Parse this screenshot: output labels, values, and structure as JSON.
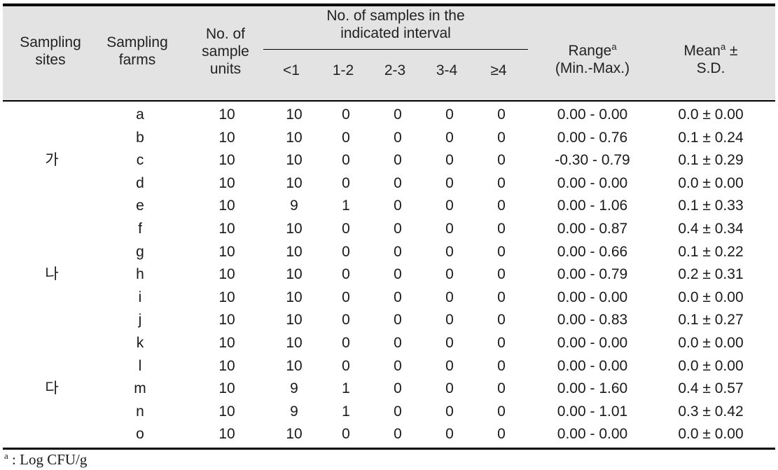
{
  "table": {
    "header": {
      "sites": "Sampling\nsites",
      "farms": "Sampling\nfarms",
      "units": "No. of\nsample\nunits",
      "interval_group": "No. of samples in the\nindicated interval",
      "intervals": [
        "<1",
        "1-2",
        "2-3",
        "3-4",
        "≥4"
      ],
      "range_label": "Range",
      "range_sup": "a",
      "range_sub": "(Min.-Max.)",
      "mean_label": "Mean",
      "mean_sup": "a",
      "mean_pm": " ±",
      "mean_sub": "S.D."
    },
    "rows": [
      {
        "site": "",
        "farm": "a",
        "units": "10",
        "i1": "10",
        "i2": "0",
        "i3": "0",
        "i4": "0",
        "i5": "0",
        "range": "0.00  -  0.00",
        "mean": "0.0  ±  0.00"
      },
      {
        "site": "",
        "farm": "b",
        "units": "10",
        "i1": "10",
        "i2": "0",
        "i3": "0",
        "i4": "0",
        "i5": "0",
        "range": "0.00  -  0.76",
        "mean": "0.1  ±  0.24"
      },
      {
        "site": "가",
        "farm": "c",
        "units": "10",
        "i1": "10",
        "i2": "0",
        "i3": "0",
        "i4": "0",
        "i5": "0",
        "range": "-0.30  -  0.79",
        "mean": "0.1  ±  0.29"
      },
      {
        "site": "",
        "farm": "d",
        "units": "10",
        "i1": "10",
        "i2": "0",
        "i3": "0",
        "i4": "0",
        "i5": "0",
        "range": "0.00  -  0.00",
        "mean": "0.0  ±  0.00"
      },
      {
        "site": "",
        "farm": "e",
        "units": "10",
        "i1": "9",
        "i2": "1",
        "i3": "0",
        "i4": "0",
        "i5": "0",
        "range": "0.00  -  1.06",
        "mean": "0.1  ±  0.33"
      },
      {
        "site": "",
        "farm": "f",
        "units": "10",
        "i1": "10",
        "i2": "0",
        "i3": "0",
        "i4": "0",
        "i5": "0",
        "range": "0.00  -  0.87",
        "mean": "0.4  ±  0.34"
      },
      {
        "site": "",
        "farm": "g",
        "units": "10",
        "i1": "10",
        "i2": "0",
        "i3": "0",
        "i4": "0",
        "i5": "0",
        "range": "0.00  -  0.66",
        "mean": "0.1  ±  0.22"
      },
      {
        "site": "나",
        "farm": "h",
        "units": "10",
        "i1": "10",
        "i2": "0",
        "i3": "0",
        "i4": "0",
        "i5": "0",
        "range": "0.00  -  0.79",
        "mean": "0.2  ±  0.31"
      },
      {
        "site": "",
        "farm": "i",
        "units": "10",
        "i1": "10",
        "i2": "0",
        "i3": "0",
        "i4": "0",
        "i5": "0",
        "range": "0.00  -  0.00",
        "mean": "0.0  ±  0.00"
      },
      {
        "site": "",
        "farm": "j",
        "units": "10",
        "i1": "10",
        "i2": "0",
        "i3": "0",
        "i4": "0",
        "i5": "0",
        "range": "0.00  -  0.83",
        "mean": "0.1  ±  0.27"
      },
      {
        "site": "",
        "farm": "k",
        "units": "10",
        "i1": "10",
        "i2": "0",
        "i3": "0",
        "i4": "0",
        "i5": "0",
        "range": "0.00  -  0.00",
        "mean": "0.0  ±  0.00"
      },
      {
        "site": "",
        "farm": "l",
        "units": "10",
        "i1": "10",
        "i2": "0",
        "i3": "0",
        "i4": "0",
        "i5": "0",
        "range": "0.00  -  0.00",
        "mean": "0.0  ±  0.00"
      },
      {
        "site": "다",
        "farm": "m",
        "units": "10",
        "i1": "9",
        "i2": "1",
        "i3": "0",
        "i4": "0",
        "i5": "0",
        "range": "0.00  -  1.60",
        "mean": "0.4  ±  0.57"
      },
      {
        "site": "",
        "farm": "n",
        "units": "10",
        "i1": "9",
        "i2": "1",
        "i3": "0",
        "i4": "0",
        "i5": "0",
        "range": "0.00  -  1.01",
        "mean": "0.3  ±  0.42"
      },
      {
        "site": "",
        "farm": "o",
        "units": "10",
        "i1": "10",
        "i2": "0",
        "i3": "0",
        "i4": "0",
        "i5": "0",
        "range": "0.00  -  0.00",
        "mean": "0.0  ±  0.00"
      }
    ],
    "footnote": {
      "sup": "a",
      "text": " :  Log  CFU/g"
    },
    "colors": {
      "header_background": "#e3e3e3",
      "rule": "#000000",
      "text": "#1a1a1a",
      "page_background": "#ffffff"
    }
  }
}
